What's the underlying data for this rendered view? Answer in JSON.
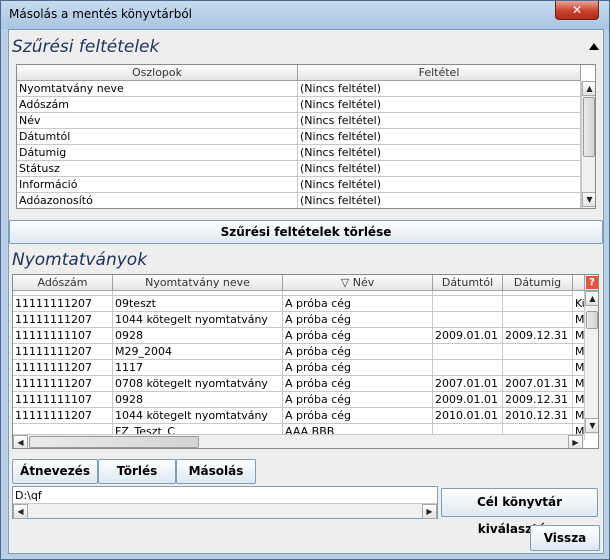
{
  "window": {
    "title": "Másolás a mentés könyvtárból",
    "close_label": "✕"
  },
  "filter": {
    "title": "Szűrési feltételek",
    "columns": [
      "Oszlopok",
      "Feltétel"
    ],
    "rows": [
      [
        "Nyomtatvány neve",
        "(Nincs feltétel)"
      ],
      [
        "Adószám",
        "(Nincs feltétel)"
      ],
      [
        "Név",
        "(Nincs feltétel)"
      ],
      [
        "Dátumtól",
        "(Nincs feltétel)"
      ],
      [
        "Dátumig",
        "(Nincs feltétel)"
      ],
      [
        "Státusz",
        "(Nincs feltétel)"
      ],
      [
        "Információ",
        "(Nincs feltétel)"
      ],
      [
        "Adóazonosító",
        "(Nincs feltétel)"
      ]
    ],
    "clear_button": "Szűrési feltételek törlése"
  },
  "forms": {
    "title": "Nyomtatványok",
    "columns": [
      "Adószám",
      "Nyomtatvány neve",
      "Név",
      "Dátumtól",
      "Dátumig"
    ],
    "sort_indicator": "▽",
    "help_icon_label": "?",
    "rows": [
      [
        "11111111207",
        "09teszt",
        "A próba cég",
        "",
        "",
        "Kü"
      ],
      [
        "11111111207",
        "1044 kötegelt nyomtatvány",
        "A próba cég",
        "",
        "",
        "Mé"
      ],
      [
        "11111111107",
        "0928",
        "A próba cég",
        "2009.01.01",
        "2009.12.31",
        "Mé"
      ],
      [
        "11111111207",
        "M29_2004",
        "A próba cég",
        "",
        "",
        "Mé"
      ],
      [
        "11111111207",
        "1117",
        "A próba cég",
        "",
        "",
        "Mé"
      ],
      [
        "11111111207",
        "0708 kötegelt nyomtatvány",
        "A próba cég",
        "2007.01.01",
        "2007.01.31",
        "Mé"
      ],
      [
        "11111111107",
        "0928",
        "A próba cég",
        "2009.01.01",
        "2009.12.31",
        "Mé"
      ],
      [
        "11111111207",
        "1044 kötegelt nyomtatvány",
        "A próba cég",
        "2010.01.01",
        "2010.12.31",
        "Mé"
      ],
      [
        "",
        "FZ_Teszt_C",
        "AAA BBB",
        "",
        "",
        "Mé"
      ]
    ]
  },
  "actions": {
    "rename": "Átnevezés",
    "delete": "Törlés",
    "copy": "Másolás"
  },
  "target": {
    "path": "D:\\qf",
    "choose_button": "Cél könyvtár kiválasztása"
  },
  "back_button": "Vissza"
}
